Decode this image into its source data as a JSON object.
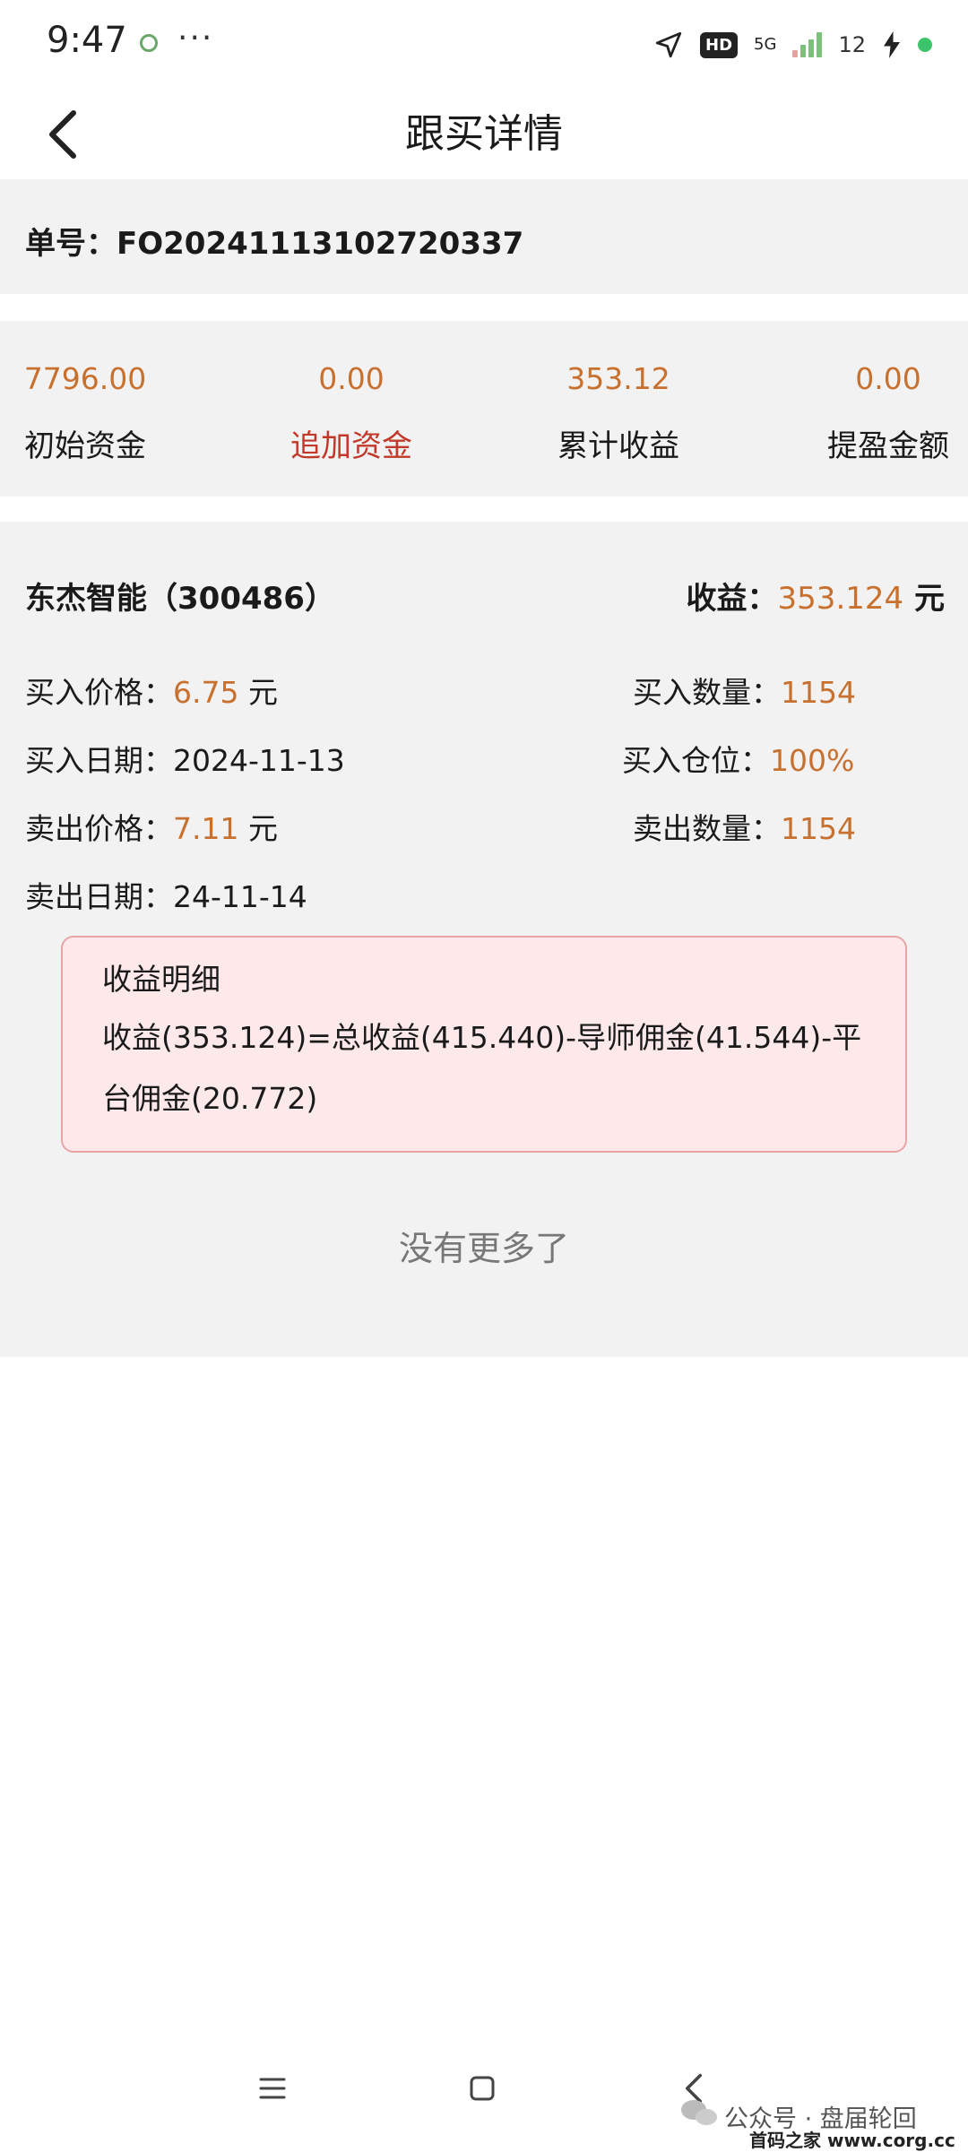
{
  "status_bar": {
    "time": "9:47",
    "dots": "···",
    "hd": "HD",
    "network": "5G",
    "battery": "12",
    "colors": {
      "signal": "#7ac27a",
      "dot": "#3cc46a"
    }
  },
  "nav": {
    "title": "跟买详情",
    "back_icon": "chevron-left-icon"
  },
  "order": {
    "label": "单号：",
    "number": "FO20241113102720337"
  },
  "stats": [
    {
      "value": "7796.00",
      "label": "初始资金",
      "highlight": false
    },
    {
      "value": "0.00",
      "label": "追加资金",
      "highlight": true
    },
    {
      "value": "353.12",
      "label": "累计收益",
      "highlight": false
    },
    {
      "value": "0.00",
      "label": "提盈金额",
      "highlight": false
    }
  ],
  "detail": {
    "stock_name": "东杰智能（300486）",
    "profit_label": "收益：",
    "profit_value": "353.124",
    "profit_unit": " 元",
    "buy_price_label": "买入价格：",
    "buy_price_value": "6.75",
    "buy_price_unit": " 元",
    "buy_qty_label": "买入数量：",
    "buy_qty_value": "1154",
    "buy_date_label": "买入日期：",
    "buy_date_value": "2024-11-13",
    "buy_position_label": "买入仓位：",
    "buy_position_value": "100%",
    "sell_price_label": "卖出价格：",
    "sell_price_value": "7.11",
    "sell_price_unit": " 元",
    "sell_qty_label": "卖出数量：",
    "sell_qty_value": "1154",
    "sell_date_label": "卖出日期：",
    "sell_date_value": "24-11-14"
  },
  "profit_box": {
    "title": "收益明细",
    "formula": "收益(353.124)=总收益(415.440)-导师佣金(41.544)-平台佣金(20.772)"
  },
  "no_more": "没有更多了",
  "watermark": {
    "line1": "公众号 · 盘届轮回",
    "line2": "首码之家 www.corg.cc"
  },
  "colors": {
    "accent": "#c8702e",
    "red": "#c0392b",
    "section_bg": "#f2f2f2",
    "box_bg": "#fde9ea",
    "box_border": "#e8a5a8"
  }
}
